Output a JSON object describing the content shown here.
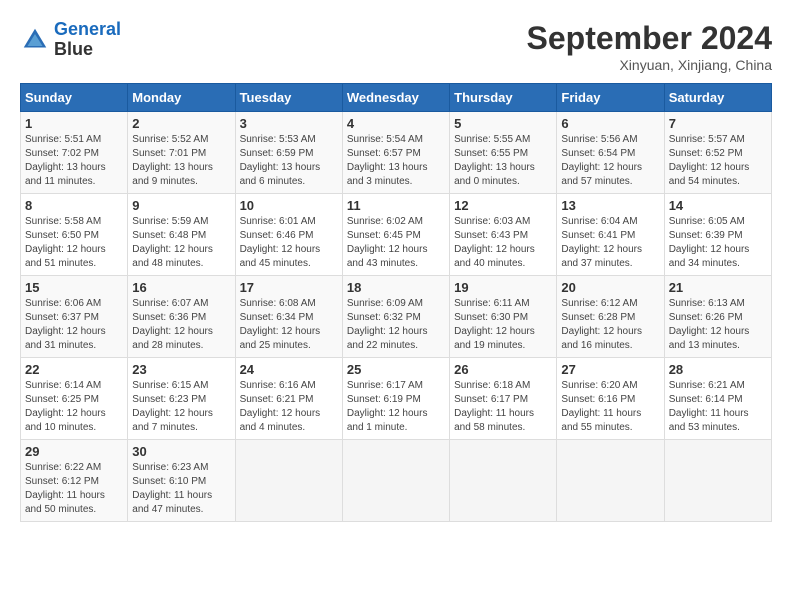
{
  "header": {
    "logo_line1": "General",
    "logo_line2": "Blue",
    "month": "September 2024",
    "location": "Xinyuan, Xinjiang, China"
  },
  "weekdays": [
    "Sunday",
    "Monday",
    "Tuesday",
    "Wednesday",
    "Thursday",
    "Friday",
    "Saturday"
  ],
  "weeks": [
    [
      {
        "day": "1",
        "info": "Sunrise: 5:51 AM\nSunset: 7:02 PM\nDaylight: 13 hours and 11 minutes."
      },
      {
        "day": "2",
        "info": "Sunrise: 5:52 AM\nSunset: 7:01 PM\nDaylight: 13 hours and 9 minutes."
      },
      {
        "day": "3",
        "info": "Sunrise: 5:53 AM\nSunset: 6:59 PM\nDaylight: 13 hours and 6 minutes."
      },
      {
        "day": "4",
        "info": "Sunrise: 5:54 AM\nSunset: 6:57 PM\nDaylight: 13 hours and 3 minutes."
      },
      {
        "day": "5",
        "info": "Sunrise: 5:55 AM\nSunset: 6:55 PM\nDaylight: 13 hours and 0 minutes."
      },
      {
        "day": "6",
        "info": "Sunrise: 5:56 AM\nSunset: 6:54 PM\nDaylight: 12 hours and 57 minutes."
      },
      {
        "day": "7",
        "info": "Sunrise: 5:57 AM\nSunset: 6:52 PM\nDaylight: 12 hours and 54 minutes."
      }
    ],
    [
      {
        "day": "8",
        "info": "Sunrise: 5:58 AM\nSunset: 6:50 PM\nDaylight: 12 hours and 51 minutes."
      },
      {
        "day": "9",
        "info": "Sunrise: 5:59 AM\nSunset: 6:48 PM\nDaylight: 12 hours and 48 minutes."
      },
      {
        "day": "10",
        "info": "Sunrise: 6:01 AM\nSunset: 6:46 PM\nDaylight: 12 hours and 45 minutes."
      },
      {
        "day": "11",
        "info": "Sunrise: 6:02 AM\nSunset: 6:45 PM\nDaylight: 12 hours and 43 minutes."
      },
      {
        "day": "12",
        "info": "Sunrise: 6:03 AM\nSunset: 6:43 PM\nDaylight: 12 hours and 40 minutes."
      },
      {
        "day": "13",
        "info": "Sunrise: 6:04 AM\nSunset: 6:41 PM\nDaylight: 12 hours and 37 minutes."
      },
      {
        "day": "14",
        "info": "Sunrise: 6:05 AM\nSunset: 6:39 PM\nDaylight: 12 hours and 34 minutes."
      }
    ],
    [
      {
        "day": "15",
        "info": "Sunrise: 6:06 AM\nSunset: 6:37 PM\nDaylight: 12 hours and 31 minutes."
      },
      {
        "day": "16",
        "info": "Sunrise: 6:07 AM\nSunset: 6:36 PM\nDaylight: 12 hours and 28 minutes."
      },
      {
        "day": "17",
        "info": "Sunrise: 6:08 AM\nSunset: 6:34 PM\nDaylight: 12 hours and 25 minutes."
      },
      {
        "day": "18",
        "info": "Sunrise: 6:09 AM\nSunset: 6:32 PM\nDaylight: 12 hours and 22 minutes."
      },
      {
        "day": "19",
        "info": "Sunrise: 6:11 AM\nSunset: 6:30 PM\nDaylight: 12 hours and 19 minutes."
      },
      {
        "day": "20",
        "info": "Sunrise: 6:12 AM\nSunset: 6:28 PM\nDaylight: 12 hours and 16 minutes."
      },
      {
        "day": "21",
        "info": "Sunrise: 6:13 AM\nSunset: 6:26 PM\nDaylight: 12 hours and 13 minutes."
      }
    ],
    [
      {
        "day": "22",
        "info": "Sunrise: 6:14 AM\nSunset: 6:25 PM\nDaylight: 12 hours and 10 minutes."
      },
      {
        "day": "23",
        "info": "Sunrise: 6:15 AM\nSunset: 6:23 PM\nDaylight: 12 hours and 7 minutes."
      },
      {
        "day": "24",
        "info": "Sunrise: 6:16 AM\nSunset: 6:21 PM\nDaylight: 12 hours and 4 minutes."
      },
      {
        "day": "25",
        "info": "Sunrise: 6:17 AM\nSunset: 6:19 PM\nDaylight: 12 hours and 1 minute."
      },
      {
        "day": "26",
        "info": "Sunrise: 6:18 AM\nSunset: 6:17 PM\nDaylight: 11 hours and 58 minutes."
      },
      {
        "day": "27",
        "info": "Sunrise: 6:20 AM\nSunset: 6:16 PM\nDaylight: 11 hours and 55 minutes."
      },
      {
        "day": "28",
        "info": "Sunrise: 6:21 AM\nSunset: 6:14 PM\nDaylight: 11 hours and 53 minutes."
      }
    ],
    [
      {
        "day": "29",
        "info": "Sunrise: 6:22 AM\nSunset: 6:12 PM\nDaylight: 11 hours and 50 minutes."
      },
      {
        "day": "30",
        "info": "Sunrise: 6:23 AM\nSunset: 6:10 PM\nDaylight: 11 hours and 47 minutes."
      },
      {
        "day": "",
        "info": ""
      },
      {
        "day": "",
        "info": ""
      },
      {
        "day": "",
        "info": ""
      },
      {
        "day": "",
        "info": ""
      },
      {
        "day": "",
        "info": ""
      }
    ]
  ]
}
